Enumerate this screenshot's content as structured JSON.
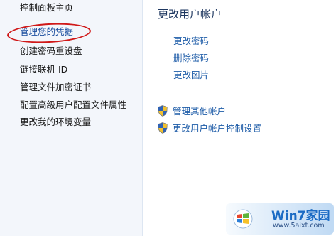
{
  "sidebar": {
    "items": [
      {
        "label": "控制面板主页"
      },
      {
        "label": "管理您的凭据"
      },
      {
        "label": "创建密码重设盘"
      },
      {
        "label": "链接联机 ID"
      },
      {
        "label": "管理文件加密证书"
      },
      {
        "label": "配置高级用户配置文件属性"
      },
      {
        "label": "更改我的环境变量"
      }
    ]
  },
  "main": {
    "title": "更改用户帐户",
    "links": [
      {
        "label": "更改密码"
      },
      {
        "label": "删除密码"
      },
      {
        "label": "更改图片"
      }
    ],
    "admin_links": [
      {
        "label": "管理其他帐户",
        "icon": "uac-shield-icon"
      },
      {
        "label": "更改用户帐户控制设置",
        "icon": "uac-shield-icon"
      }
    ]
  },
  "watermark": {
    "brand": "Win7家园",
    "url": "www.5aixt.com"
  },
  "colors": {
    "sidebar_bg": "#f3f6fb",
    "link_blue": "#1e5ca8",
    "title_blue": "#1e3760",
    "highlight_red": "#d01818"
  }
}
